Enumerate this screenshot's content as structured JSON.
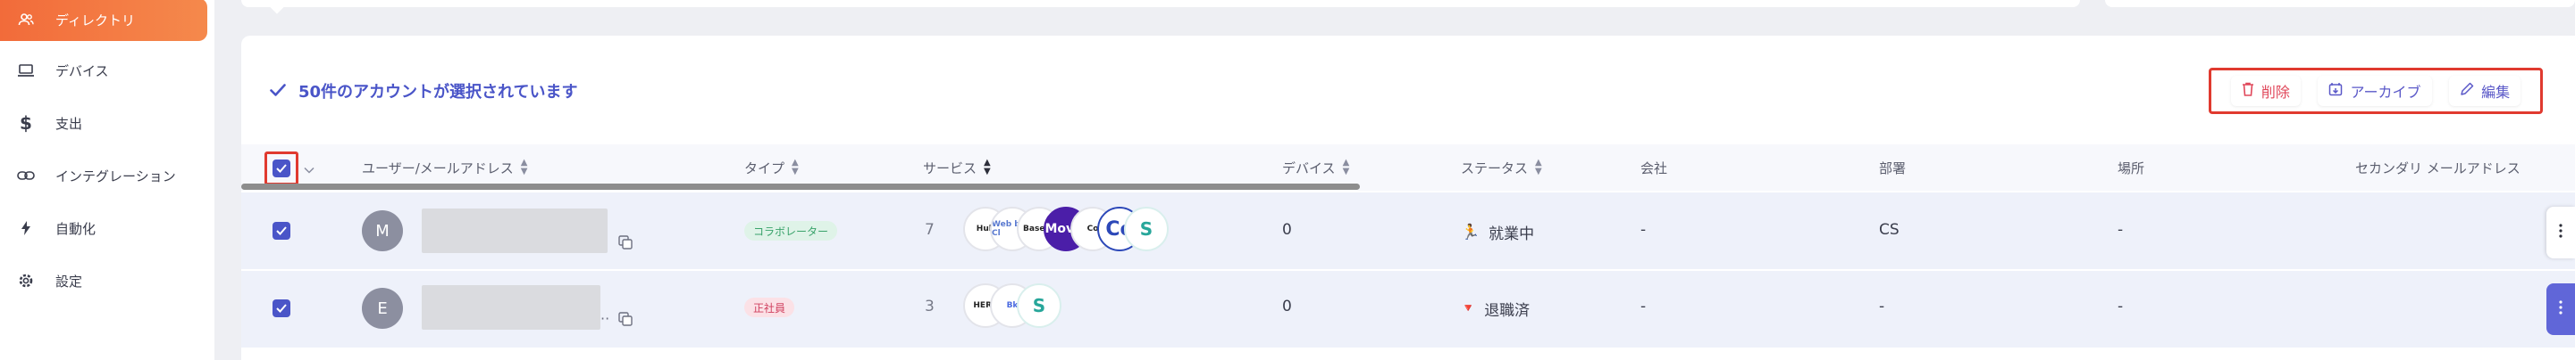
{
  "sidebar": {
    "items": [
      {
        "label": "ディレクトリ",
        "icon": "users-icon",
        "active": true
      },
      {
        "label": "デバイス",
        "icon": "laptop-icon"
      },
      {
        "label": "支出",
        "icon": "dollar-icon"
      },
      {
        "label": "インテグレーション",
        "icon": "link-icon"
      },
      {
        "label": "自動化",
        "icon": "bolt-icon"
      },
      {
        "label": "設定",
        "icon": "gear-icon"
      }
    ]
  },
  "selection": {
    "text": "50件のアカウントが選択されています"
  },
  "actions": {
    "delete": "削除",
    "archive": "アーカイブ",
    "edit": "編集"
  },
  "table": {
    "columns": {
      "user": "ユーザー/メールアドレス",
      "type": "タイプ",
      "service": "サービス",
      "device": "デバイス",
      "status": "ステータス",
      "company": "会社",
      "department": "部署",
      "location": "場所",
      "secondary_email": "セカンダリ メールアドレス"
    },
    "rows": [
      {
        "avatar": "M",
        "type": "コラボレーター",
        "service_count": "7",
        "service_icons": [
          "Hub",
          "Web by Cl",
          "Baseco",
          "Movio",
          "Co",
          "Co",
          "S"
        ],
        "device": "0",
        "status": "就業中",
        "status_icon": "🏃",
        "company": "-",
        "department": "CS",
        "location": "-"
      },
      {
        "avatar": "E",
        "type": "正社員",
        "service_count": "3",
        "service_icons": [
          "HERP",
          "Bk",
          "S"
        ],
        "device": "0",
        "status": "退職済",
        "status_icon": "🔻",
        "company": "-",
        "department": "-",
        "location": "-"
      }
    ]
  },
  "colors": {
    "accent": "#4a55c8",
    "active_nav": "#f26b3a",
    "danger": "#e03a2f"
  }
}
